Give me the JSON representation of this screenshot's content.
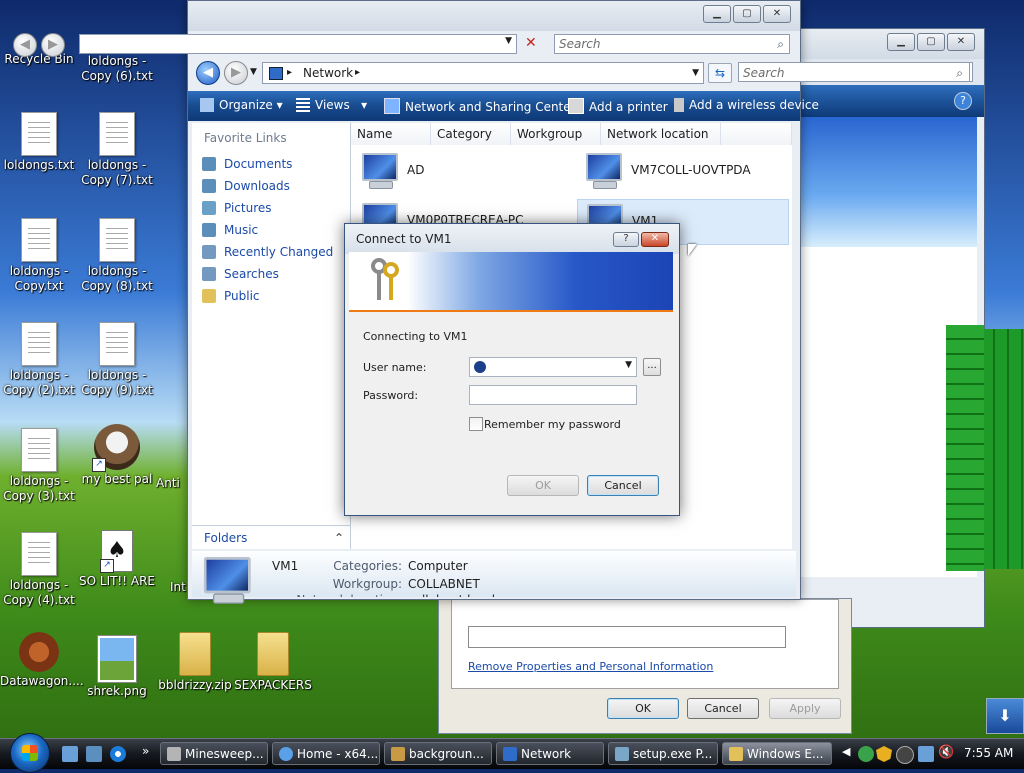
{
  "desktop": {
    "icons": [
      {
        "label": "Recycle Bin"
      },
      {
        "label": "loldongs -\nCopy (6).txt"
      },
      {
        "label": "loldongs.txt"
      },
      {
        "label": "loldongs -\nCopy (7).txt"
      },
      {
        "label": "loldongs -\nCopy.txt"
      },
      {
        "label": "loldongs -\nCopy (8).txt"
      },
      {
        "label": "loldongs -\nCopy (2).txt"
      },
      {
        "label": "loldongs -\nCopy (9).txt"
      },
      {
        "label": "loldongs -\nCopy (3).txt"
      },
      {
        "label": "my best pal"
      },
      {
        "label": "loldongs -\nCopy (4).txt"
      },
      {
        "label": "SO LIT!! ARE"
      },
      {
        "label": "Datawagon...."
      },
      {
        "label": "shrek.png"
      },
      {
        "label": "bbldrizzy.zip"
      },
      {
        "label": "SEXPACKERS"
      },
      {
        "label": "Anti"
      },
      {
        "label": "Int"
      }
    ]
  },
  "explorer": {
    "search_placeholder_top": "Search",
    "address_root": "Network",
    "search_placeholder": "Search",
    "toolbar": {
      "organize": "Organize",
      "views": "Views",
      "network_sharing": "Network and Sharing Center",
      "add_printer": "Add a printer",
      "add_wireless": "Add a wireless device"
    },
    "favorite_links_header": "Favorite Links",
    "favorite_links": [
      "Documents",
      "Downloads",
      "Pictures",
      "Music",
      "Recently Changed",
      "Searches",
      "Public"
    ],
    "folders_label": "Folders",
    "columns": [
      "Name",
      "Category",
      "Workgroup",
      "Network location"
    ],
    "items": [
      "AD",
      "VM7COLL-UOVTPDA",
      "VM0P0TRECREA-PC",
      "VM1"
    ],
    "details": {
      "name": "VM1",
      "categories_label": "Categories:",
      "categories_value": "Computer",
      "workgroup_label": "Workgroup:",
      "workgroup_value": "COLLABNET",
      "network_location_label": "Network location:",
      "network_location_value": "collabnet.local"
    }
  },
  "explorer2": {
    "search_placeholder": "Search"
  },
  "properties": {
    "remove_link": "Remove Properties and Personal Information",
    "ok": "OK",
    "cancel": "Cancel",
    "apply": "Apply"
  },
  "connect_dialog": {
    "title": "Connect to VM1",
    "connecting_text": "Connecting to VM1",
    "username_label": "User name:",
    "password_label": "Password:",
    "remember_label": "Remember my password",
    "browse": "...",
    "ok": "OK",
    "cancel": "Cancel"
  },
  "taskbar": {
    "tasks": [
      "Minesweep...",
      "Home - x64...",
      "backgroun...",
      "Network",
      "setup.exe P...",
      "Windows E..."
    ],
    "overflow": "»",
    "clock": "7:55 AM"
  }
}
